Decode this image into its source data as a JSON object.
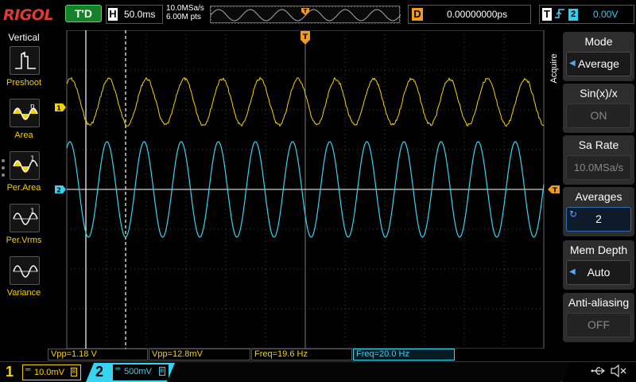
{
  "topbar": {
    "logo": "RIGOL",
    "run_status": "T'D",
    "timebase_label": "H",
    "timebase_value": "50.0ms",
    "sample_rate": "10.0MSa/s",
    "memory_points": "6.00M pts",
    "delay_label": "D",
    "delay_value": "0.00000000ps",
    "trigger_label": "T",
    "trigger_edge_icon": "rising-edge-icon",
    "trigger_source": "2",
    "trigger_level": "0.00V"
  },
  "left_menu": {
    "title": "Vertical",
    "items": [
      {
        "label": "Preshoot",
        "icon": "preshoot-icon"
      },
      {
        "label": "Area",
        "icon": "area-icon"
      },
      {
        "label": "Per.Area",
        "icon": "period-area-icon"
      },
      {
        "label": "Per.Vrms",
        "icon": "period-vrms-icon"
      },
      {
        "label": "Variance",
        "icon": "variance-icon"
      }
    ]
  },
  "right_menu": {
    "tab_label": "Acquire",
    "buttons": [
      {
        "title": "Mode",
        "value": "Average",
        "state": "selectable"
      },
      {
        "title": "Sin(x)/x",
        "value": "ON",
        "state": "disabled"
      },
      {
        "title": "Sa Rate",
        "value": "10.0MSa/s",
        "state": "disabled"
      },
      {
        "title": "Averages",
        "value": "2",
        "state": "active"
      },
      {
        "title": "Mem Depth",
        "value": "Auto",
        "state": "selectable"
      },
      {
        "title": "Anti-aliasing",
        "value": "OFF",
        "state": "disabled"
      }
    ]
  },
  "waveform": {
    "ch1_marker": "1",
    "ch2_marker": "2",
    "trigger_pos_marker": "T",
    "trigger_level_marker": "T",
    "ch1_color": "#f5d200",
    "ch2_color": "#35d5f2",
    "ch1_cycles": 12.6,
    "ch2_cycles": 12.85
  },
  "measurements": [
    {
      "text": "Vpp=1.18 V",
      "channel": "1"
    },
    {
      "text": "Vpp=12.8mV",
      "channel": "1"
    },
    {
      "text": "Freq=19.6 Hz",
      "channel": "1"
    },
    {
      "text": "Freq=20.0 Hz",
      "channel": "2"
    }
  ],
  "bottombar": {
    "ch1": {
      "number": "1",
      "scale": "10.0mV",
      "coupling_icon": "dc-coupling-icon",
      "bw_mark": "B"
    },
    "ch2": {
      "number": "2",
      "scale": "500mV",
      "coupling_icon": "dc-coupling-icon",
      "bw_mark": "B"
    },
    "usb_icon": "usb-icon",
    "speaker_icon": "speaker-mute-icon"
  }
}
